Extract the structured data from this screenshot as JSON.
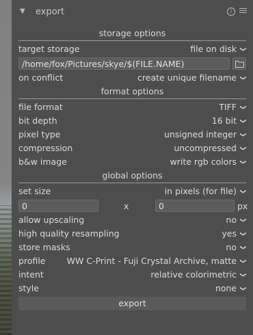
{
  "header": {
    "title": "export"
  },
  "sections": {
    "storage": "storage options",
    "format": "format options",
    "global": "global options"
  },
  "storage": {
    "target_label": "target storage",
    "target_value": "file on disk",
    "path_value": "/home/fox/Pictures/skye/$(FILE.NAME)",
    "conflict_label": "on conflict",
    "conflict_value": "create unique filename"
  },
  "format": {
    "file_format_label": "file format",
    "file_format_value": "TIFF",
    "bit_depth_label": "bit depth",
    "bit_depth_value": "16 bit",
    "pixel_type_label": "pixel type",
    "pixel_type_value": "unsigned integer",
    "compression_label": "compression",
    "compression_value": "uncompressed",
    "bw_label": "b&w image",
    "bw_value": "write rgb colors"
  },
  "global": {
    "set_size_label": "set size",
    "set_size_value": "in pixels (for file)",
    "width_value": "0",
    "x_sep": "x",
    "height_value": "0",
    "unit": "px",
    "upscale_label": "allow upscaling",
    "upscale_value": "no",
    "hq_label": "high quality resampling",
    "hq_value": "yes",
    "masks_label": "store masks",
    "masks_value": "no",
    "profile_label": "profile",
    "profile_value": "WW C-Print - Fuji Crystal Archive, matte",
    "intent_label": "intent",
    "intent_value": "relative colorimetric",
    "style_label": "style",
    "style_value": "none"
  },
  "actions": {
    "export_label": "export"
  },
  "icons": [
    "collapse-triangle-icon",
    "info-icon",
    "menu-icon",
    "folder-icon",
    "chevron-down-icon"
  ]
}
